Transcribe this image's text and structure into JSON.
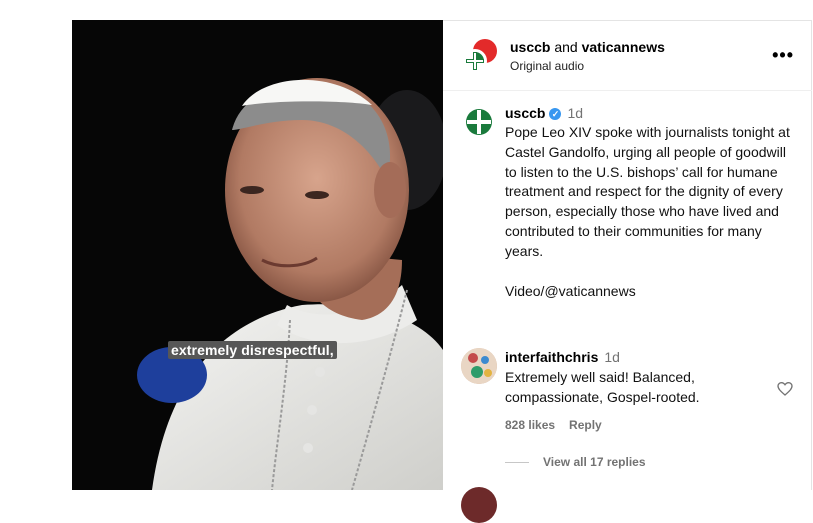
{
  "video": {
    "caption": "extremely disrespectful,"
  },
  "header": {
    "account1": "usccb",
    "joiner": "and",
    "account2": "vaticannews",
    "audio": "Original audio",
    "more_icon": "more-horizontal-icon"
  },
  "post": {
    "username": "usccb",
    "verified_icon": "verified-badge-icon",
    "time": "1d",
    "text": "Pope Leo XIV spoke with journalists tonight at Castel Gandolfo, urging all people of goodwill to listen to the U.S. bishops’ call for humane treatment and respect for the dignity of every person, especially those who have lived and contributed to their communities for many years.",
    "credit": "Video/@vaticannews"
  },
  "comment": {
    "username": "interfaithchris",
    "time": "1d",
    "text": "Extremely well said! Balanced, compassionate, Gospel-rooted.",
    "likes": "828 likes",
    "reply_label": "Reply",
    "view_replies": "View all 17 replies",
    "heart_icon": "heart-outline-icon"
  },
  "colors": {
    "brand_green": "#1a7a3c",
    "brand_red": "#e32a2a",
    "verified_blue": "#3897f0",
    "muted": "#737373"
  }
}
